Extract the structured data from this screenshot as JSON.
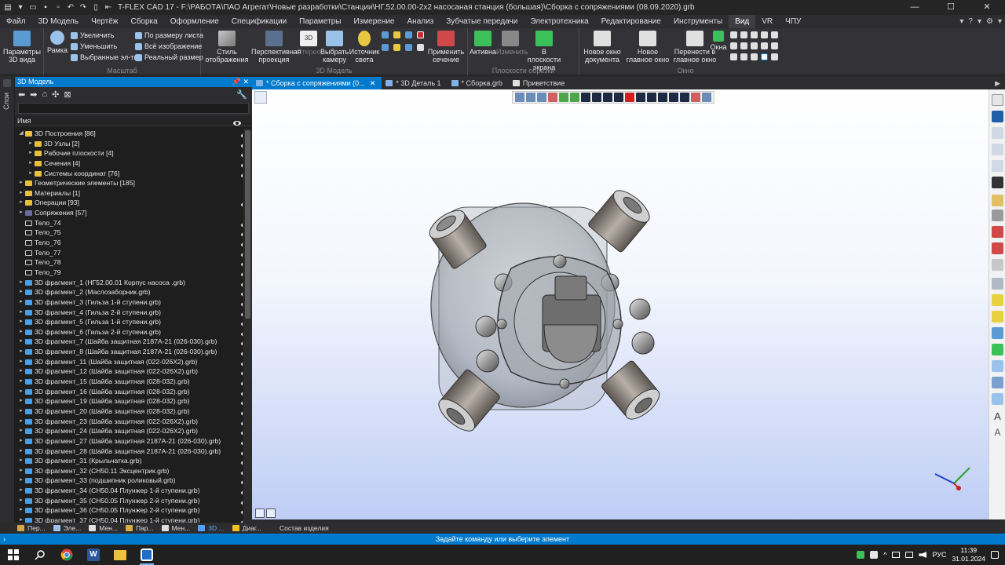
{
  "app": {
    "title": "T-FLEX CAD 17 - F:\\РАБОТА\\ПАО Агрегат\\Новые разработки\\Станции\\НГ.52.00.00-2х2 насосаная станция (большая)\\Сборка с сопряжениями (08.09.2020).grb",
    "window_controls": [
      "—",
      "☐",
      "✕"
    ]
  },
  "menu": {
    "items": [
      "Файл",
      "3D Модель",
      "Чертёж",
      "Сборка",
      "Оформление",
      "Спецификации",
      "Параметры",
      "Измерение",
      "Анализ",
      "Зубчатые передачи",
      "Электротехника",
      "Редактирование",
      "Инструменты",
      "Вид",
      "VR",
      "ЧПУ"
    ],
    "active": "Вид",
    "right_icons": [
      "▾",
      "?",
      "▾",
      "⚙",
      "▾"
    ]
  },
  "ribbon": {
    "groups": {
      "g1": {
        "label": ""
      },
      "g2": {
        "label": "Масштаб"
      },
      "g3": {
        "label": "3D Модель"
      },
      "g4": {
        "label": "Плоскости обрезки"
      },
      "g5": {
        "label": "Окно"
      }
    },
    "buttons": {
      "params_3d": "Параметры 3D вида",
      "frame": "Рамка",
      "zoom_in": "Увеличить",
      "zoom_out": "Уменьшить",
      "selected": "Выбранные эл-ты",
      "fit_sheet": "По размеру листа",
      "all_image": "Всё изображение",
      "real_size": "Реальный размер",
      "display_style": "Стиль отображения",
      "perspective": "Перспективная проекция",
      "stereo": "Стерео",
      "choose_camera": "Выбрать камеру",
      "light_source": "Источник света",
      "apply_section": "Применить сечение",
      "active": "Активна",
      "change": "Изменить",
      "in_screen_plane": "В плоскости экрана",
      "new_doc_window": "Новое окно документа",
      "new_main_window": "Новое главное окно",
      "move_to_main": "Перенести в главное окно",
      "windows": "Окна"
    }
  },
  "left_strip": {
    "label": "Слои"
  },
  "panel": {
    "title": "3D Модель",
    "pin": "📌",
    "close": "✕",
    "column_header": "Имя",
    "tree": [
      {
        "label": "3D Построения [86]",
        "level": 0,
        "expanded": true,
        "icon": "folder",
        "eye": true
      },
      {
        "label": "3D Узлы [2]",
        "level": 1,
        "expanded": false,
        "icon": "folder",
        "eye": true
      },
      {
        "label": "Рабочие плоскости [4]",
        "level": 1,
        "expanded": false,
        "icon": "folder",
        "eye": true
      },
      {
        "label": "Сечения [4]",
        "level": 1,
        "expanded": false,
        "icon": "folder",
        "eye": true
      },
      {
        "label": "Системы координат [76]",
        "level": 1,
        "expanded": false,
        "icon": "folder",
        "eye": true
      },
      {
        "label": "Геометрические элементы [185]",
        "level": 0,
        "expanded": false,
        "icon": "folder",
        "eye": false
      },
      {
        "label": "Материалы [1]",
        "level": 0,
        "expanded": false,
        "icon": "folder",
        "eye": false
      },
      {
        "label": "Операции [93]",
        "level": 0,
        "expanded": false,
        "icon": "ops",
        "eye": true
      },
      {
        "label": "Сопряжения [57]",
        "level": 0,
        "expanded": false,
        "icon": "mate",
        "eye": false
      },
      {
        "label": "Тело_74",
        "level": 0,
        "expanded": null,
        "icon": "body",
        "eye": true
      },
      {
        "label": "Тело_75",
        "level": 0,
        "expanded": null,
        "icon": "body",
        "eye": true
      },
      {
        "label": "Тело_76",
        "level": 0,
        "expanded": null,
        "icon": "body",
        "eye": true
      },
      {
        "label": "Тело_77",
        "level": 0,
        "expanded": null,
        "icon": "body",
        "eye": true
      },
      {
        "label": "Тело_78",
        "level": 0,
        "expanded": null,
        "icon": "body",
        "eye": true
      },
      {
        "label": "Тело_79",
        "level": 0,
        "expanded": null,
        "icon": "body",
        "eye": true
      },
      {
        "label": "3D фрагмент_1 (НГ52.00.01 Корпус насоса .grb)",
        "level": 0,
        "expanded": false,
        "icon": "frag",
        "eye": true
      },
      {
        "label": "3D фрагмент_2 (Маслозаборник.grb)",
        "level": 0,
        "expanded": false,
        "icon": "frag",
        "eye": true
      },
      {
        "label": "3D фрагмент_3 (Гильза 1-й ступени.grb)",
        "level": 0,
        "expanded": false,
        "icon": "frag",
        "eye": true
      },
      {
        "label": "3D фрагмент_4 (Гильза 2-й ступени.grb)",
        "level": 0,
        "expanded": false,
        "icon": "frag",
        "eye": true
      },
      {
        "label": "3D фрагмент_5 (Гильза 1-й ступени.grb)",
        "level": 0,
        "expanded": false,
        "icon": "frag",
        "eye": true
      },
      {
        "label": "3D фрагмент_6 (Гильза 2-й ступени.grb)",
        "level": 0,
        "expanded": false,
        "icon": "frag",
        "eye": true
      },
      {
        "label": "3D фрагмент_7 (Шайба защитная 2187А-21 (026-030).grb)",
        "level": 0,
        "expanded": false,
        "icon": "frag",
        "eye": true
      },
      {
        "label": "3D фрагмент_8 (Шайба защитная 2187А-21 (026-030).grb)",
        "level": 0,
        "expanded": false,
        "icon": "frag",
        "eye": true
      },
      {
        "label": "3D фрагмент_11 (Шайба защитная (022-026X2).grb)",
        "level": 0,
        "expanded": false,
        "icon": "frag",
        "eye": true
      },
      {
        "label": "3D фрагмент_12 (Шайба защитная (022-026X2).grb)",
        "level": 0,
        "expanded": false,
        "icon": "frag",
        "eye": true
      },
      {
        "label": "3D фрагмент_15 (Шайба защитная (028-032).grb)",
        "level": 0,
        "expanded": false,
        "icon": "frag",
        "eye": true
      },
      {
        "label": "3D фрагмент_16 (Шайба защитная (028-032).grb)",
        "level": 0,
        "expanded": false,
        "icon": "frag",
        "eye": true
      },
      {
        "label": "3D фрагмент_19 (Шайба защитная (028-032).grb)",
        "level": 0,
        "expanded": false,
        "icon": "frag",
        "eye": true
      },
      {
        "label": "3D фрагмент_20 (Шайба защитная (028-032).grb)",
        "level": 0,
        "expanded": false,
        "icon": "frag",
        "eye": true
      },
      {
        "label": "3D фрагмент_23 (Шайба защитная (022-026X2).grb)",
        "level": 0,
        "expanded": false,
        "icon": "frag",
        "eye": true
      },
      {
        "label": "3D фрагмент_24 (Шайба защитная (022-026X2).grb)",
        "level": 0,
        "expanded": false,
        "icon": "frag",
        "eye": true
      },
      {
        "label": "3D фрагмент_27 (Шайба защитная 2187А-21 (026-030).grb)",
        "level": 0,
        "expanded": false,
        "icon": "frag",
        "eye": true
      },
      {
        "label": "3D фрагмент_28 (Шайба защитная 2187А-21 (026-030).grb)",
        "level": 0,
        "expanded": false,
        "icon": "frag",
        "eye": true
      },
      {
        "label": "3D фрагмент_31 (Крыльчатка.grb)",
        "level": 0,
        "expanded": false,
        "icon": "frag",
        "eye": true
      },
      {
        "label": "3D фрагмент_32 (СН50.11 Эксцентрик.grb)",
        "level": 0,
        "expanded": false,
        "icon": "frag",
        "eye": true
      },
      {
        "label": "3D фрагмент_33 (подшипник роликовый.grb)",
        "level": 0,
        "expanded": false,
        "icon": "frag",
        "eye": true
      },
      {
        "label": "3D фрагмент_34 (СН50.04 Плунжер 1-й ступени.grb)",
        "level": 0,
        "expanded": false,
        "icon": "frag",
        "eye": true
      },
      {
        "label": "3D фрагмент_35 (СН50.05 Плунжер 2-й ступени.grb)",
        "level": 0,
        "expanded": false,
        "icon": "frag",
        "eye": true
      },
      {
        "label": "3D фрагмент_36 (СН50.05 Плунжер 2-й ступени.grb)",
        "level": 0,
        "expanded": false,
        "icon": "frag",
        "eye": true
      },
      {
        "label": "3D фрагмент_37 (СН50.04 Плунжер 1-й ступени.grb)",
        "level": 0,
        "expanded": false,
        "icon": "frag",
        "eye": true
      }
    ]
  },
  "doc_tabs": [
    {
      "label": "* Сборка с сопряжениями (0...",
      "active": true,
      "close": "✕"
    },
    {
      "label": "* 3D Деталь 1",
      "active": false
    },
    {
      "label": "* Сборка.grb",
      "active": false
    },
    {
      "label": "Приветствие",
      "active": false
    }
  ],
  "bottom_tabs": [
    {
      "label": "Пер...",
      "active": false,
      "color": "#d4a84a"
    },
    {
      "label": "Эле...",
      "active": false,
      "color": "#9bc2ea"
    },
    {
      "label": "Мен...",
      "active": false,
      "color": "#e0e0e0"
    },
    {
      "label": "Пар...",
      "active": false,
      "color": "#d8b040"
    },
    {
      "label": "Мен...",
      "active": false,
      "color": "#e0e0e0"
    },
    {
      "label": "3D ...",
      "active": true,
      "color": "#4fa3ff"
    },
    {
      "label": "Диаг...",
      "active": false,
      "color": "#f0c020"
    },
    {
      "label": "Состав изделия",
      "active": false,
      "color": "transparent"
    }
  ],
  "status": {
    "left": "›",
    "message": "Задайте команду или выберите элемент"
  },
  "taskbar": {
    "apps": [
      "windows-start",
      "search",
      "chrome",
      "word",
      "explorer",
      "tflex"
    ],
    "tray": {
      "chevron": "^",
      "lang": "РУС",
      "time": "11:39",
      "date": "31.01.2024"
    }
  },
  "colors": {
    "accent": "#007acc",
    "ribbon_bg": "#333337",
    "viewport_top": "#ffffff",
    "viewport_bottom": "#bfcdf5"
  }
}
